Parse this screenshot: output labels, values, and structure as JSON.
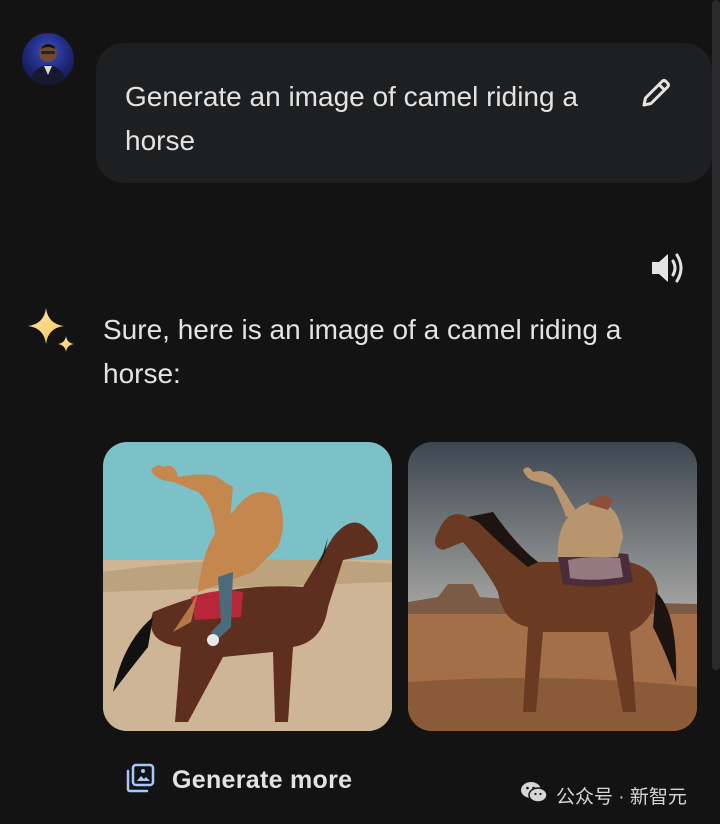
{
  "user_prompt": {
    "text": "Generate an image of camel riding a horse",
    "avatar_icon": "user-avatar",
    "edit_icon": "pencil-icon"
  },
  "response": {
    "text": "Sure, here is an image of a camel riding a horse:",
    "speaker_icon": "volume-icon",
    "assistant_icon": "sparkle-icon",
    "images": [
      {
        "alt": "camel riding a horse image 1"
      },
      {
        "alt": "camel riding a horse image 2"
      }
    ],
    "generate_more_label": "Generate more",
    "generate_more_icon": "image-generate-icon"
  },
  "watermark": {
    "text": "公众号 · 新智元",
    "icon": "wechat-icon"
  }
}
